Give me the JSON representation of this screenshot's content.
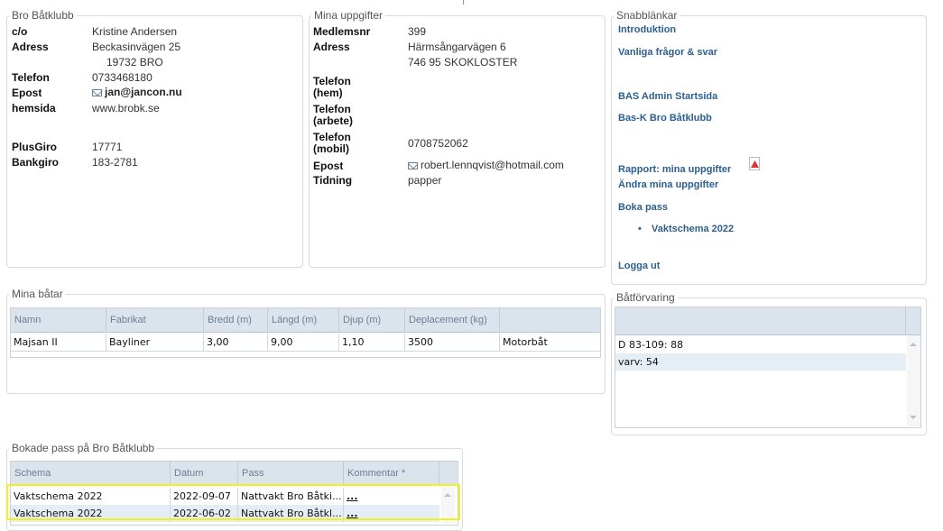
{
  "club": {
    "legend": "Bro Båtklubb",
    "co_label": "c/o",
    "co_value": "Kristine Andersen",
    "address_label": "Adress",
    "address_line1": "Beckasinvägen 25",
    "address_line2": "19732 BRO",
    "phone_label": "Telefon",
    "phone_value": "0733468180",
    "email_label": "Epost",
    "email_value": "jan@jancon.nu",
    "web_label": "hemsida",
    "web_value": "www.brobk.se",
    "plusgiro_label": "PlusGiro",
    "plusgiro_value": "17771",
    "bankgiro_label": "Bankgiro",
    "bankgiro_value": "183-2781"
  },
  "member": {
    "legend": "Mina uppgifter",
    "number_label": "Medlemsnr",
    "number_value": "399",
    "address_label": "Adress",
    "address_line1": "Härmsångarvägen 6",
    "address_line2": "746 95 SKOKLOSTER",
    "phone_home_label_1": "Telefon",
    "phone_home_label_2": "(hem)",
    "phone_work_label_1": "Telefon",
    "phone_work_label_2": "(arbete)",
    "phone_mobile_label_1": "Telefon",
    "phone_mobile_label_2": "(mobil)",
    "phone_mobile_value": "0708752062",
    "email_label": "Epost",
    "email_value": "robert.lennqvist@hotmail.com",
    "paper_label": "Tidning",
    "paper_value": "papper"
  },
  "quicklinks": {
    "legend": "Snabblänkar",
    "intro": "Introduktion",
    "faq": "Vanliga frågor & svar",
    "bas_admin": "BAS Admin Startsida",
    "bas_k": "Bas-K Bro Båtklubb",
    "report": "Rapport: mina uppgifter",
    "edit": "Ändra mina uppgifter",
    "book": "Boka pass",
    "schedule_bullet": "•",
    "schedule": "Vaktschema 2022",
    "logout": "Logga ut"
  },
  "boats": {
    "legend": "Mina båtar",
    "columns": [
      "Namn",
      "Fabrikat",
      "Bredd (m)",
      "Längd (m)",
      "Djup (m)",
      "Deplacement (kg)",
      ""
    ],
    "rows": [
      [
        "Majsan II",
        "Bayliner",
        "3,00",
        "9,00",
        "1,10",
        "3500",
        "Motorbåt"
      ]
    ]
  },
  "storage": {
    "legend": "Båtförvaring",
    "rows": [
      "D 83-109: 88",
      "varv: 54"
    ]
  },
  "bookings": {
    "legend": "Bokade pass på Bro Båtklubb",
    "columns": [
      "Schema",
      "Datum",
      "Pass",
      "Kommentar *"
    ],
    "rows": [
      [
        "Vaktschema 2022",
        "2022-09-07",
        "Nattvakt Bro Båtki...",
        "..."
      ],
      [
        "Vaktschema 2022",
        "2022-06-02",
        "Nattvakt Bro Båtkl...",
        "..."
      ]
    ]
  },
  "colors": {
    "link": "#2b5f8f",
    "grid_header": "#dbe3ec",
    "row_alt": "#e6eef5",
    "highlight": "#f2f21a"
  },
  "icons": [
    "mail-icon",
    "pdf-icon",
    "scroll-up-icon",
    "scroll-down-icon"
  ]
}
